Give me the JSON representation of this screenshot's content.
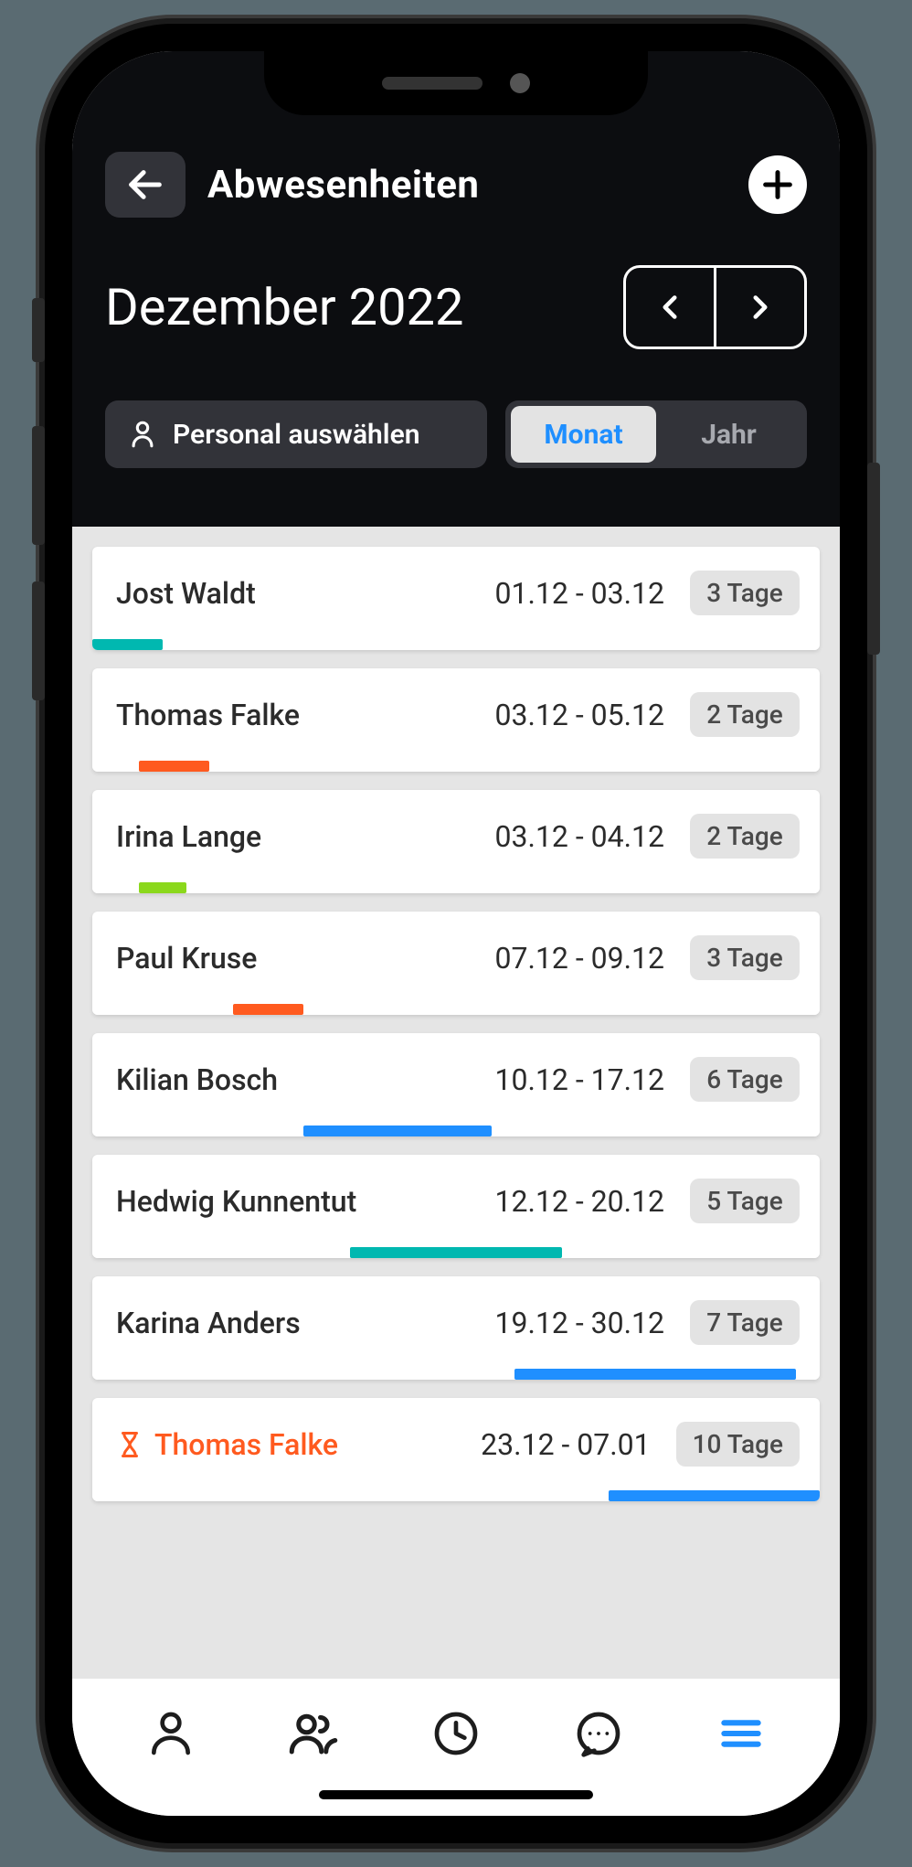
{
  "header": {
    "title": "Abwesenheiten",
    "month_label": "Dezember 2022",
    "select_personal_label": "Personal auswählen",
    "seg_month": "Monat",
    "seg_year": "Jahr"
  },
  "days_in_month": 31,
  "colors": {
    "teal": "#00b8b0",
    "orange": "#ff5a1f",
    "green": "#8bd81c",
    "blue": "#1f8fff"
  },
  "absences": [
    {
      "name": "Jost Waldt",
      "range": "01.12 - 03.12",
      "days": "3 Tage",
      "bar_start": 1,
      "bar_end": 3,
      "color": "teal",
      "pending": false
    },
    {
      "name": "Thomas Falke",
      "range": "03.12 - 05.12",
      "days": "2 Tage",
      "bar_start": 3,
      "bar_end": 5,
      "color": "orange",
      "pending": false
    },
    {
      "name": "Irina Lange",
      "range": "03.12 - 04.12",
      "days": "2 Tage",
      "bar_start": 3,
      "bar_end": 4,
      "color": "green",
      "pending": false
    },
    {
      "name": "Paul Kruse",
      "range": "07.12 - 09.12",
      "days": "3 Tage",
      "bar_start": 7,
      "bar_end": 9,
      "color": "orange",
      "pending": false
    },
    {
      "name": "Kilian Bosch",
      "range": "10.12 - 17.12",
      "days": "6 Tage",
      "bar_start": 10,
      "bar_end": 17,
      "color": "blue",
      "pending": false
    },
    {
      "name": "Hedwig Kunnentut",
      "range": "12.12 - 20.12",
      "days": "5 Tage",
      "bar_start": 12,
      "bar_end": 20,
      "color": "teal",
      "pending": false
    },
    {
      "name": "Karina Anders",
      "range": "19.12 - 30.12",
      "days": "7 Tage",
      "bar_start": 19,
      "bar_end": 30,
      "color": "blue",
      "pending": false
    },
    {
      "name": "Thomas Falke",
      "range": "23.12 - 07.01",
      "days": "10 Tage",
      "bar_start": 23,
      "bar_end": 31,
      "color": "blue",
      "pending": true
    }
  ]
}
